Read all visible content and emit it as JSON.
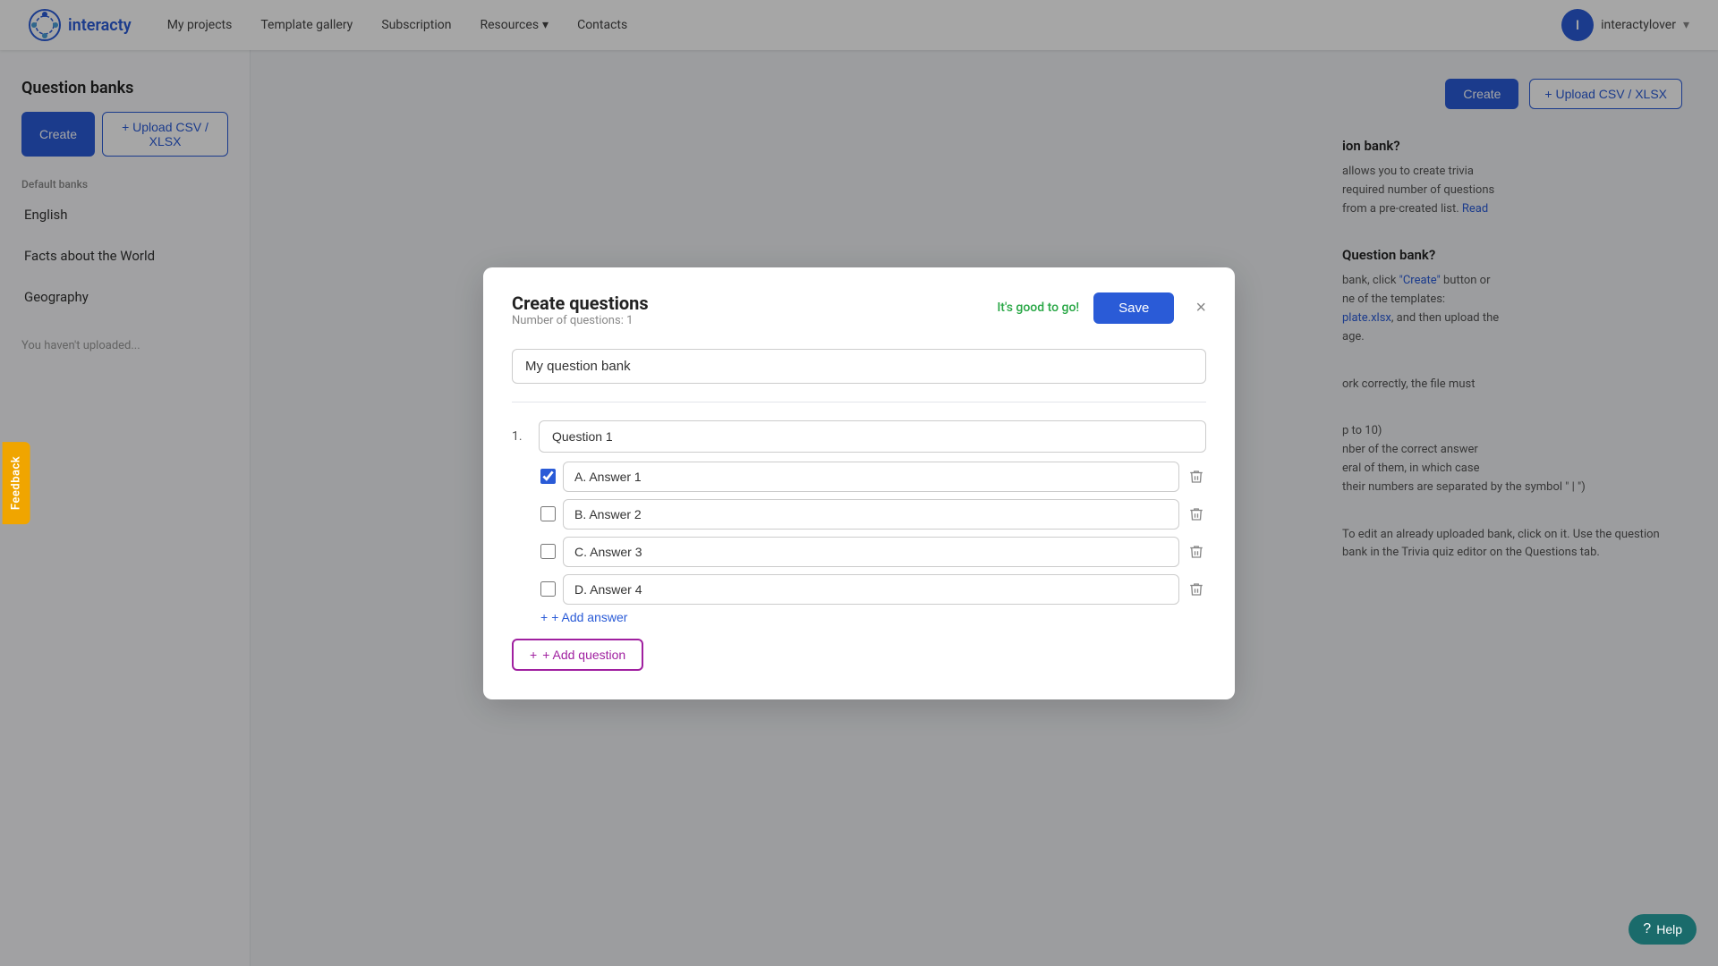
{
  "navbar": {
    "logo_text": "interacty",
    "logo_initial": "I",
    "links": [
      {
        "label": "My projects",
        "id": "my-projects"
      },
      {
        "label": "Template gallery",
        "id": "template-gallery"
      },
      {
        "label": "Subscription",
        "id": "subscription"
      },
      {
        "label": "Resources",
        "id": "resources",
        "has_dropdown": true
      },
      {
        "label": "Contacts",
        "id": "contacts"
      }
    ],
    "user_initial": "I",
    "user_name": "interactylover"
  },
  "page": {
    "title": "Question banks",
    "create_btn": "Create",
    "upload_btn": "+ Upload CSV / XLSX",
    "section_label": "Default banks",
    "bank_items": [
      {
        "label": "English",
        "id": "english"
      },
      {
        "label": "Facts about the World",
        "id": "facts-world"
      },
      {
        "label": "Geography",
        "id": "geography"
      }
    ],
    "sidebar_empty_text": "You haven't uploaded..."
  },
  "right_panel": {
    "info_blocks": [
      {
        "question": "ion bank?",
        "text": "allows you to create trivia\nrequired number of questions\nfrom a pre-created list.",
        "link_text": "Read",
        "id": "info1"
      },
      {
        "question": "Question bank?",
        "text": "bank, click ",
        "link_text": "\"Create\"",
        "text2": " button or\nne of the templates:\n",
        "link2_text": "plate.xlsx",
        "text3": ", and then upload the\nage.",
        "id": "info2"
      },
      {
        "text": "ork correctly, the file must",
        "id": "info3"
      },
      {
        "text": "p to 10)\nnber of the correct answer\neral of them, in which case\ntheir numbers are separated by the symbol \" | \")",
        "id": "info4"
      },
      {
        "text": "To edit an already uploaded bank, click on it. Use the question bank in the Trivia quiz editor on the Questions tab.",
        "id": "info5"
      }
    ]
  },
  "modal": {
    "title": "Create questions",
    "subtitle": "Number of questions: 1",
    "good_to_go": "It's good to go!",
    "save_btn": "Save",
    "bank_name_placeholder": "My question bank",
    "bank_name_value": "My question bank",
    "close_btn": "×",
    "questions": [
      {
        "num": "1.",
        "placeholder": "Question 1",
        "value": "Question 1",
        "answers": [
          {
            "label": "A. Answer 1",
            "checked": true,
            "id": "a1"
          },
          {
            "label": "B. Answer 2",
            "checked": false,
            "id": "a2"
          },
          {
            "label": "C. Answer 3",
            "checked": false,
            "id": "a3"
          },
          {
            "label": "D. Answer 4",
            "checked": false,
            "id": "a4"
          }
        ],
        "add_answer_label": "+ Add answer"
      }
    ],
    "add_question_label": "+ Add question"
  },
  "feedback": {
    "label": "Feedback"
  },
  "help": {
    "label": "Help"
  }
}
